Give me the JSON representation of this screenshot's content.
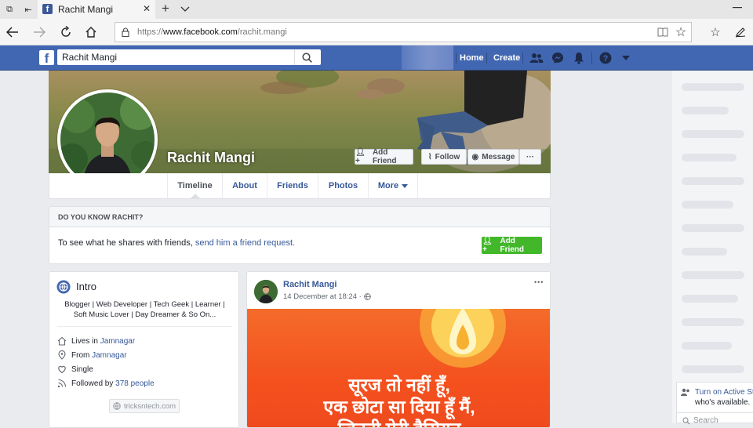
{
  "browser": {
    "tab_title": "Rachit Mangi",
    "url_scheme": "https://",
    "url_domain": "www.facebook.com",
    "url_path": "/rachit.mangi",
    "new_tab": "+",
    "dropdown": "⌵"
  },
  "fbbar": {
    "logo": "f",
    "search_value": "Rachit Mangi",
    "home": "Home",
    "create": "Create"
  },
  "profile": {
    "name": "Rachit Mangi",
    "add_friend": "Add Friend",
    "follow": "Follow",
    "message": "Message",
    "more_dots": "···",
    "tabs": [
      "Timeline",
      "About",
      "Friends",
      "Photos",
      "More"
    ]
  },
  "know": {
    "header": "DO YOU KNOW RACHIT?",
    "text": "To see what he shares with friends,",
    "link": "send him a friend request.",
    "button": "Add Friend"
  },
  "intro": {
    "title": "Intro",
    "bio_line1": "Blogger | Web Developer | Tech Geek | Learner |",
    "bio_line2": "Soft Music Lover | Day Dreamer & So On...",
    "lives_prefix": "Lives in",
    "lives_city": "Jamnagar",
    "from_prefix": "From",
    "from_city": "Jamnagar",
    "relationship": "Single",
    "followed_prefix": "Followed by",
    "followed_count": "378 people",
    "website": "tricksntech.com"
  },
  "post": {
    "author": "Rachit Mangi",
    "time": "14 December at 18:24 ·",
    "menu": "•••",
    "image_line1": "सूरज तो नहीं हूँ,",
    "image_line2": "एक छोटा सा दिया हूँ मैं,",
    "image_line3": "जितनी मेरी हैसियत"
  },
  "chat": {
    "turn_on": "Turn on Active Sta",
    "turn_on_2": "who's available.",
    "search": "Search"
  },
  "colors": {
    "fb_blue": "#4267b2",
    "link_blue": "#365899",
    "green": "#42b72a",
    "post_orange": "#f4511e"
  }
}
